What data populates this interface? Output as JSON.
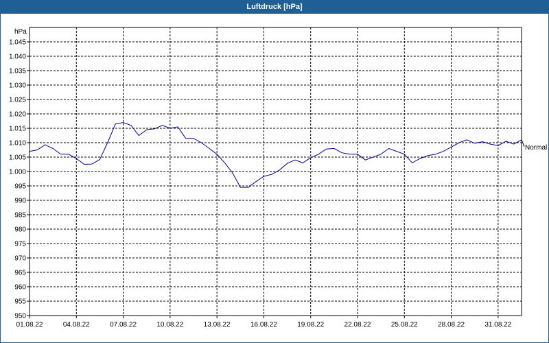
{
  "window": {
    "title": "Luftdruck [hPa]"
  },
  "chart_data": {
    "type": "line",
    "title": "Luftdruck [hPa]",
    "ylabel": "hPa",
    "xlabel": "",
    "ylim": [
      950,
      1050
    ],
    "yticks": [
      "950",
      "955",
      "960",
      "965",
      "970",
      "975",
      "980",
      "985",
      "990",
      "995",
      "1.000",
      "1.005",
      "1.010",
      "1.015",
      "1.020",
      "1.025",
      "1.030",
      "1.035",
      "1.040",
      "1.045"
    ],
    "ytick_values": [
      950,
      955,
      960,
      965,
      970,
      975,
      980,
      985,
      990,
      995,
      1000,
      1005,
      1010,
      1015,
      1020,
      1025,
      1030,
      1035,
      1040,
      1045
    ],
    "xlim": [
      1,
      32.5
    ],
    "xticks": [
      "01.08.22",
      "04.08.22",
      "07.08.22",
      "10.08.22",
      "13.08.22",
      "16.08.22",
      "19.08.22",
      "22.08.22",
      "25.08.22",
      "28.08.22",
      "31.08.22"
    ],
    "xtick_values": [
      1,
      4,
      7,
      10,
      13,
      16,
      19,
      22,
      25,
      28,
      31
    ],
    "grid": true,
    "series": [
      {
        "name": "Normal",
        "color": "#00008b",
        "x": [
          1.0,
          1.5,
          2.0,
          2.5,
          3.0,
          3.5,
          4.0,
          4.5,
          5.0,
          5.5,
          6.0,
          6.5,
          7.0,
          7.5,
          8.0,
          8.5,
          9.0,
          9.5,
          10.0,
          10.5,
          11.0,
          11.5,
          12.0,
          12.5,
          13.0,
          13.5,
          14.0,
          14.5,
          15.0,
          15.5,
          16.0,
          16.5,
          17.0,
          17.5,
          18.0,
          18.5,
          19.0,
          19.5,
          20.0,
          20.5,
          21.0,
          21.5,
          22.0,
          22.5,
          23.0,
          23.5,
          24.0,
          24.5,
          25.0,
          25.5,
          26.0,
          26.5,
          27.0,
          27.5,
          28.0,
          28.5,
          29.0,
          29.5,
          30.0,
          30.5,
          31.0,
          31.5,
          32.0,
          32.5
        ],
        "values": [
          1007,
          1007.5,
          1009.3,
          1008,
          1006,
          1006,
          1004.5,
          1002.5,
          1002.6,
          1004.2,
          1010,
          1016.5,
          1017,
          1016,
          1012.5,
          1014.5,
          1014.8,
          1016,
          1015,
          1015.5,
          1011.5,
          1011.5,
          1010,
          1008,
          1006,
          1003,
          999.5,
          994.5,
          994.5,
          996.5,
          998.3,
          999,
          1000.5,
          1002.8,
          1004,
          1003,
          1004.8,
          1006,
          1007.8,
          1008,
          1006.5,
          1006,
          1006,
          1004,
          1005,
          1006,
          1008,
          1007,
          1006,
          1003,
          1004.5,
          1005.5,
          1006,
          1007,
          1008.5,
          1010,
          1011,
          1009.8,
          1010.3,
          1009.5,
          1009,
          1010.5,
          1009.5,
          1011
        ]
      }
    ]
  }
}
